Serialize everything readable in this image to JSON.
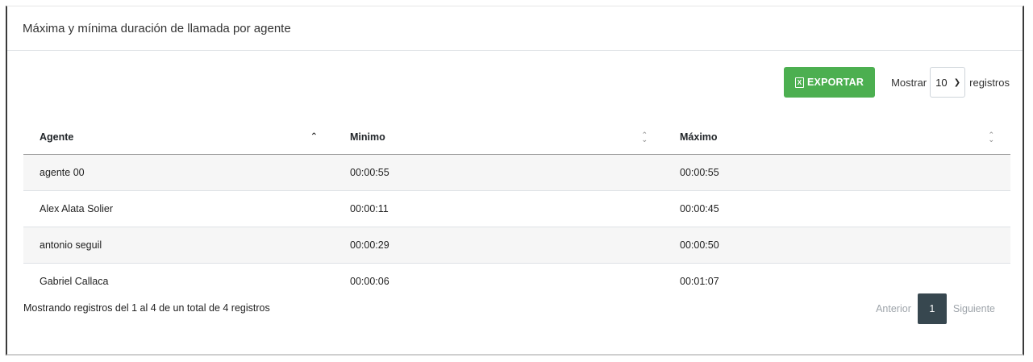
{
  "panel": {
    "title": "Máxima y mínima duración de llamada por agente"
  },
  "toolbar": {
    "export_label": "EXPORTAR",
    "export_icon": "excel-file-icon",
    "show_label": "Mostrar",
    "page_size": "10",
    "records_label": "registros"
  },
  "table": {
    "columns": [
      "Agente",
      "Minimo",
      "Máximo"
    ],
    "sort": {
      "Agente": "ascending",
      "Minimo": "none",
      "Máximo": "none"
    },
    "rows": [
      [
        "agente 00",
        "00:00:55",
        "00:00:55"
      ],
      [
        "Alex Alata Solier",
        "00:00:11",
        "00:00:45"
      ],
      [
        "antonio seguil",
        "00:00:29",
        "00:00:50"
      ],
      [
        "Gabriel Callaca",
        "00:00:06",
        "00:01:07"
      ]
    ]
  },
  "footer": {
    "info": "Mostrando registros del 1 al 4 de un total de 4 registros",
    "prev": "Anterior",
    "current_page": "1",
    "next": "Siguiente"
  },
  "colors": {
    "export_button": "#4caf50",
    "active_page": "#37474f"
  }
}
